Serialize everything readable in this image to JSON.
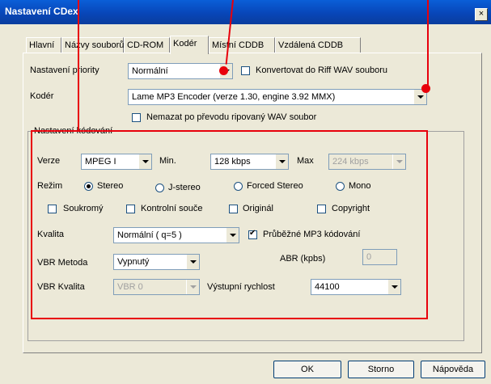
{
  "window": {
    "title": "Nastavení CDex",
    "close": "×"
  },
  "tabs": [
    "Hlavní",
    "Názvy souborů",
    "CD-ROM",
    "Kodér",
    "Místní CDDB",
    "Vzdálená CDDB"
  ],
  "priority": {
    "label": "Nastavení priority",
    "value": "Normální"
  },
  "riff": {
    "label": "Konvertovat do Riff WAV souboru",
    "checked": false
  },
  "encoder": {
    "label": "Kodér",
    "value": "Lame MP3 Encoder (verze 1.30, engine 3.92 MMX)"
  },
  "keep_wav": {
    "label": "Nemazat po převodu ripovaný WAV soubor",
    "checked": false
  },
  "group": {
    "title": "Nastavení kódování",
    "version": {
      "label": "Verze",
      "value": "MPEG I"
    },
    "min": {
      "label": "Min.",
      "value": "128 kbps"
    },
    "max": {
      "label": "Max",
      "value": "224 kbps"
    },
    "mode": {
      "label": "Režim",
      "options": [
        "Stereo",
        "J-stereo",
        "Forced Stereo",
        "Mono"
      ],
      "selected": "Stereo"
    },
    "flags": {
      "private": "Soukromý",
      "crc": "Kontrolní souče",
      "original": "Originál",
      "copyright": "Copyright"
    },
    "quality": {
      "label": "Kvalita",
      "value": "Normální ( q=5 )"
    },
    "on_the_fly": {
      "label": "Průběžné MP3 kódování",
      "checked": true
    },
    "vbr_method": {
      "label": "VBR Metoda",
      "value": "Vypnutý"
    },
    "abr": {
      "label": "ABR (kpbs)",
      "value": "0"
    },
    "vbr_quality": {
      "label": "VBR Kvalita",
      "value": "VBR 0"
    },
    "out_rate": {
      "label": "Výstupní rychlost",
      "value": "44100"
    }
  },
  "buttons": {
    "ok": "OK",
    "cancel": "Storno",
    "help": "Nápověda"
  }
}
